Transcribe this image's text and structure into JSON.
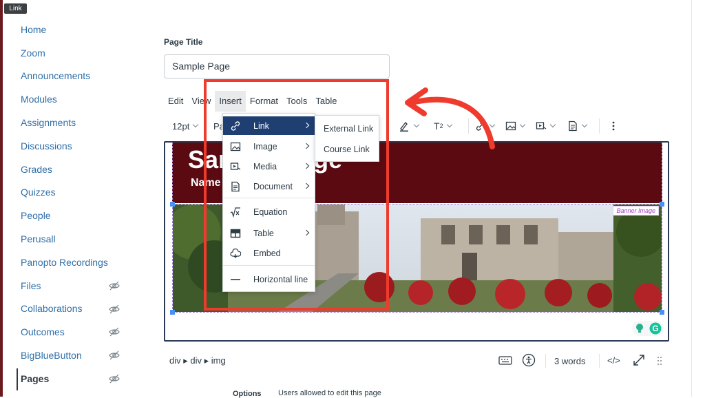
{
  "tooltip": "Link",
  "sidebar": {
    "items": [
      {
        "label": "Home",
        "hidden": false
      },
      {
        "label": "Zoom",
        "hidden": false
      },
      {
        "label": "Announcements",
        "hidden": false
      },
      {
        "label": "Modules",
        "hidden": false
      },
      {
        "label": "Assignments",
        "hidden": false
      },
      {
        "label": "Discussions",
        "hidden": false
      },
      {
        "label": "Grades",
        "hidden": false
      },
      {
        "label": "Quizzes",
        "hidden": false
      },
      {
        "label": "People",
        "hidden": false
      },
      {
        "label": "Perusall",
        "hidden": false
      },
      {
        "label": "Panopto Recordings",
        "hidden": false
      },
      {
        "label": "Files",
        "hidden": true
      },
      {
        "label": "Collaborations",
        "hidden": true
      },
      {
        "label": "Outcomes",
        "hidden": true
      },
      {
        "label": "BigBlueButton",
        "hidden": true
      },
      {
        "label": "Pages",
        "hidden": true,
        "active": true
      }
    ]
  },
  "page_title": {
    "label": "Page Title",
    "value": "Sample Page"
  },
  "menubar": {
    "items": [
      "Edit",
      "View",
      "Insert",
      "Format",
      "Tools",
      "Table"
    ],
    "active": "Insert"
  },
  "toolbar": {
    "font_size": "12pt",
    "paragraph": "Pa",
    "superscript": "2"
  },
  "insert_menu": {
    "items": [
      {
        "label": "Link",
        "icon": "link-icon",
        "submenu": true,
        "highlighted": true
      },
      {
        "label": "Image",
        "icon": "image-icon",
        "submenu": true
      },
      {
        "label": "Media",
        "icon": "media-icon",
        "submenu": true
      },
      {
        "label": "Document",
        "icon": "document-icon",
        "submenu": true
      },
      {
        "label": "Equation",
        "icon": "equation-icon",
        "submenu": false
      },
      {
        "label": "Table",
        "icon": "table-icon",
        "submenu": true
      },
      {
        "label": "Embed",
        "icon": "embed-icon",
        "submenu": false
      },
      {
        "label": "Horizontal line",
        "icon": "horizontal-line-icon",
        "submenu": false
      }
    ]
  },
  "link_submenu": {
    "items": [
      "External Link",
      "Course Link"
    ]
  },
  "editor": {
    "banner_title": "Sample Page",
    "banner_subtitle": "Name",
    "banner_tag": "Banner Image"
  },
  "statusbar": {
    "path": "div ▸ div ▸ img",
    "word_count": "3 words",
    "html_toggle": "</>"
  },
  "options": {
    "label": "Options",
    "users_text": "Users allowed to edit this page"
  },
  "colors": {
    "link": "#2f6fa7",
    "banner": "#5c0a12",
    "highlight": "#1f3f73",
    "annotation": "#ef3b2d"
  }
}
